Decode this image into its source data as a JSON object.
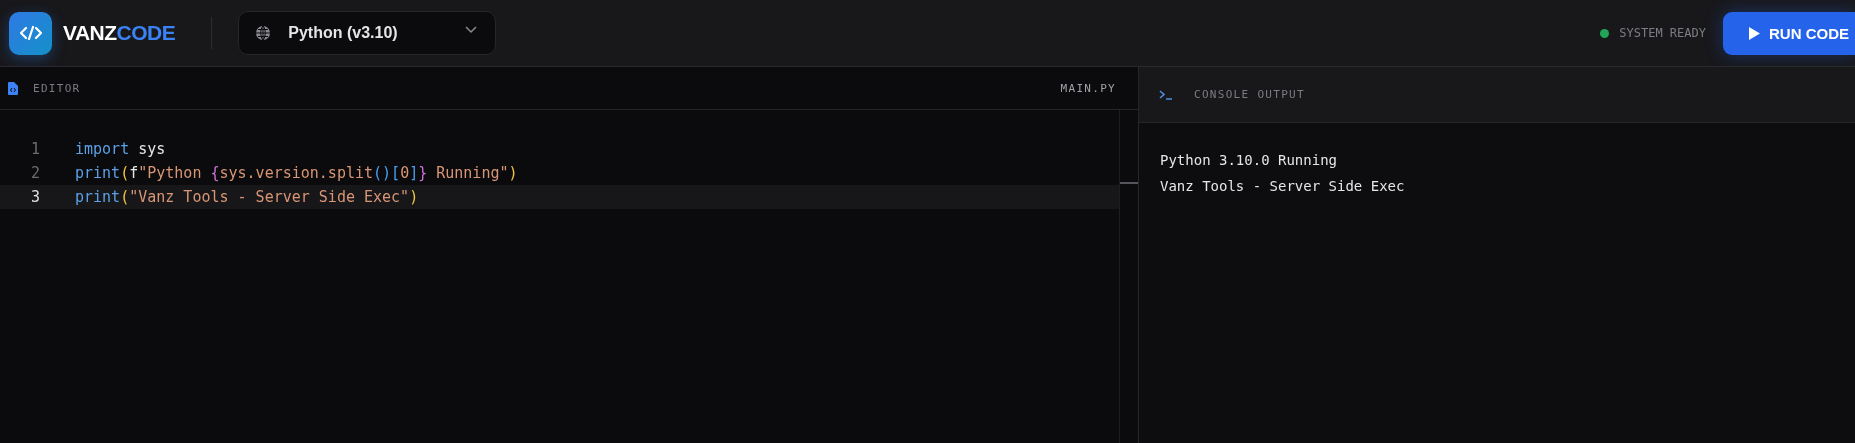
{
  "header": {
    "brand": {
      "part_1": "VANZ",
      "part_2": "CODE"
    },
    "language": {
      "label": "Python (v3.10)"
    },
    "status": {
      "label": "SYSTEM READY",
      "color": "#22a559"
    },
    "run_button": {
      "label": "RUN CODE"
    }
  },
  "editor": {
    "title": "EDITOR",
    "file": "MAIN.PY",
    "lines": [
      {
        "number": "1",
        "selected": false,
        "tokens": [
          {
            "kind": "keyword",
            "text": "import"
          },
          {
            "kind": "plain",
            "text": " sys"
          }
        ]
      },
      {
        "number": "2",
        "selected": false,
        "tokens": [
          {
            "kind": "keyword",
            "text": "print"
          },
          {
            "kind": "paren",
            "text": "("
          },
          {
            "kind": "plain",
            "text": "f"
          },
          {
            "kind": "string",
            "text": "\"Python "
          },
          {
            "kind": "brace",
            "text": "{"
          },
          {
            "kind": "string",
            "text": "sys.version.split"
          },
          {
            "kind": "bracket",
            "text": "()["
          },
          {
            "kind": "string",
            "text": "0"
          },
          {
            "kind": "bracket",
            "text": "]"
          },
          {
            "kind": "brace",
            "text": "}"
          },
          {
            "kind": "string",
            "text": " Running\""
          },
          {
            "kind": "paren",
            "text": ")"
          }
        ]
      },
      {
        "number": "3",
        "selected": true,
        "tokens": [
          {
            "kind": "keyword",
            "text": "print"
          },
          {
            "kind": "paren",
            "text": "("
          },
          {
            "kind": "string",
            "text": "\"Vanz Tools - Server Side Exec\""
          },
          {
            "kind": "paren",
            "text": ")"
          }
        ]
      }
    ]
  },
  "console": {
    "title": "CONSOLE OUTPUT",
    "lines": [
      "Python 3.10.0 Running",
      "Vanz Tools - Server Side Exec"
    ]
  }
}
